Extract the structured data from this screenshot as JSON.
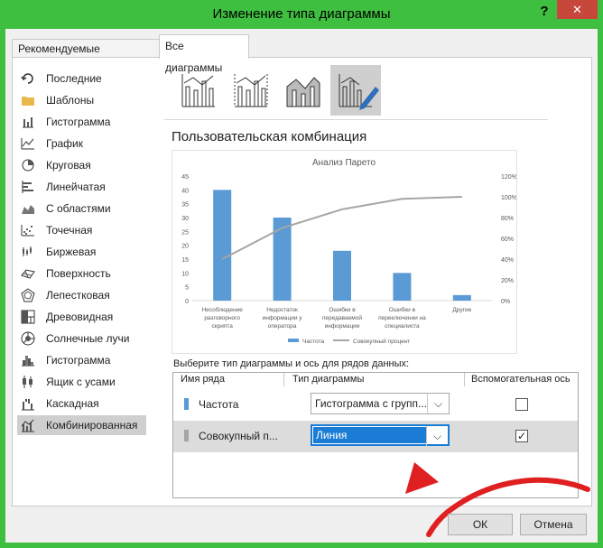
{
  "window": {
    "title": "Изменение типа диаграммы",
    "help_glyph": "?",
    "close_glyph": "✕"
  },
  "tabs": [
    {
      "label": "Рекомендуемые диаграммы",
      "active": false
    },
    {
      "label": "Все диаграммы",
      "active": true
    }
  ],
  "sidebar": {
    "items": [
      {
        "label": "Последние",
        "icon": "recent-icon"
      },
      {
        "label": "Шаблоны",
        "icon": "folder-icon"
      },
      {
        "label": "Гистограмма",
        "icon": "column-chart-icon"
      },
      {
        "label": "График",
        "icon": "line-chart-icon"
      },
      {
        "label": "Круговая",
        "icon": "pie-chart-icon"
      },
      {
        "label": "Линейчатая",
        "icon": "bar-chart-icon"
      },
      {
        "label": "С областями",
        "icon": "area-chart-icon"
      },
      {
        "label": "Точечная",
        "icon": "scatter-chart-icon"
      },
      {
        "label": "Биржевая",
        "icon": "stock-chart-icon"
      },
      {
        "label": "Поверхность",
        "icon": "surface-chart-icon"
      },
      {
        "label": "Лепестковая",
        "icon": "radar-chart-icon"
      },
      {
        "label": "Древовидная",
        "icon": "treemap-chart-icon"
      },
      {
        "label": "Солнечные лучи",
        "icon": "sunburst-chart-icon"
      },
      {
        "label": "Гистограмма",
        "icon": "histogram-chart-icon"
      },
      {
        "label": "Ящик с усами",
        "icon": "box-whisker-chart-icon"
      },
      {
        "label": "Каскадная",
        "icon": "waterfall-chart-icon"
      },
      {
        "label": "Комбинированная",
        "icon": "combo-chart-icon",
        "selected": true
      }
    ]
  },
  "subtypes": [
    {
      "icon": "combo-column-line-icon"
    },
    {
      "icon": "combo-column-line-secondary-icon"
    },
    {
      "icon": "combo-area-column-icon"
    },
    {
      "icon": "combo-custom-icon",
      "selected": true
    }
  ],
  "heading": "Пользовательская комбинация",
  "chart_data": {
    "type": "bar",
    "title": "Анализ Парето",
    "categories": [
      "Несоблюдение разговорного скрипта",
      "Недостаток информации у оператора",
      "Ошибки в передаваемой информации",
      "Ошибки в переключении на специалиста",
      "Другие"
    ],
    "category_lines": [
      [
        "Несоблюдение",
        "разговорного",
        "скрипта"
      ],
      [
        "Недостаток",
        "информации у",
        "оператора"
      ],
      [
        "Ошибки в",
        "передаваемой",
        "информации"
      ],
      [
        "Ошибки в",
        "переключении на",
        "специалиста"
      ],
      [
        "Другие"
      ]
    ],
    "series": [
      {
        "name": "Частота",
        "type": "bar",
        "values": [
          40,
          30,
          18,
          10,
          2
        ],
        "color": "#5b9bd5"
      },
      {
        "name": "Совокупный процент",
        "type": "line",
        "axis": "secondary",
        "values": [
          40,
          70,
          88,
          98,
          100
        ],
        "color": "#a5a5a5"
      }
    ],
    "y_ticks": [
      "0",
      "5",
      "10",
      "15",
      "20",
      "25",
      "30",
      "35",
      "40",
      "45"
    ],
    "y2_ticks": [
      "0%",
      "20%",
      "40%",
      "60%",
      "80%",
      "100%",
      "120%"
    ],
    "ylim": [
      0,
      45
    ],
    "y2lim": [
      0,
      120
    ],
    "legend_position": "bottom"
  },
  "series_section": {
    "label": "Выберите тип диаграммы и ось для рядов данных:",
    "headers": {
      "name": "Имя ряда",
      "type": "Тип диаграммы",
      "secondary": "Вспомогательная ось"
    },
    "rows": [
      {
        "name": "Частота",
        "type": "Гистограмма с групп...",
        "secondary": false,
        "marker_color": "#5b9bd5",
        "selected": false
      },
      {
        "name": "Совокупный п...",
        "type": "Линия",
        "secondary": true,
        "marker_color": "#a5a5a5",
        "selected": true
      }
    ],
    "dropdown_glyph": "⌵",
    "check_glyph": "✓"
  },
  "buttons": {
    "ok": "ОК",
    "cancel": "Отмена"
  },
  "colors": {
    "titlebar": "#3fbf3f",
    "close": "#c7483b",
    "accent": "#1a7cd4",
    "annotation_arrow": "#e02020"
  }
}
